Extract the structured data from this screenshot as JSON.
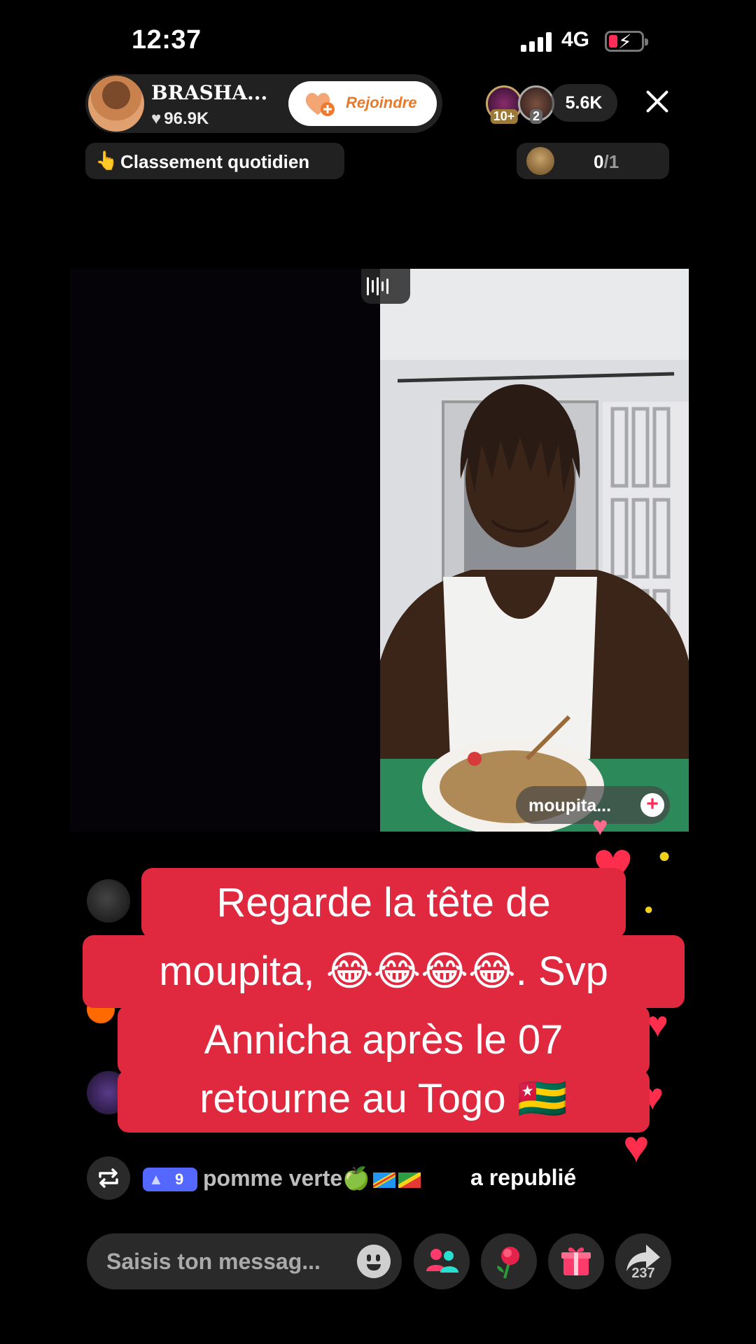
{
  "status_bar": {
    "time": "12:37",
    "network": "4G",
    "battery_level": 0.2,
    "battery_color": "#ff2d55"
  },
  "header": {
    "host_name": "BRASHA...",
    "host_likes": "96.9K",
    "join_label": "Rejoindre",
    "viewer_badges": [
      "10+",
      "2"
    ],
    "viewer_count": "5.6K",
    "close_icon": "close-icon"
  },
  "sub_header": {
    "ranking_label": "Classement quotidien",
    "ranking_icon": "👆",
    "goal_current": "0",
    "goal_total": "/1"
  },
  "video": {
    "guest_name": "moupita...",
    "guest_follow_icon": "plus-icon"
  },
  "caption": {
    "lines": [
      "Regarde la tête de",
      "moupita, 😂😂😂😂. Svp",
      "Annicha après le 07",
      "retourne au Togo 🇹🇬"
    ],
    "color": "#e0283f"
  },
  "repost": {
    "level": "9",
    "user": "pomme verte🍏",
    "action": "a republié"
  },
  "bottom_bar": {
    "input_placeholder": "Saisis ton messag...",
    "share_count": "237",
    "buttons": [
      "emoji-icon",
      "multi-guest-icon",
      "rose-gift-icon",
      "gift-icon",
      "share-icon"
    ]
  }
}
